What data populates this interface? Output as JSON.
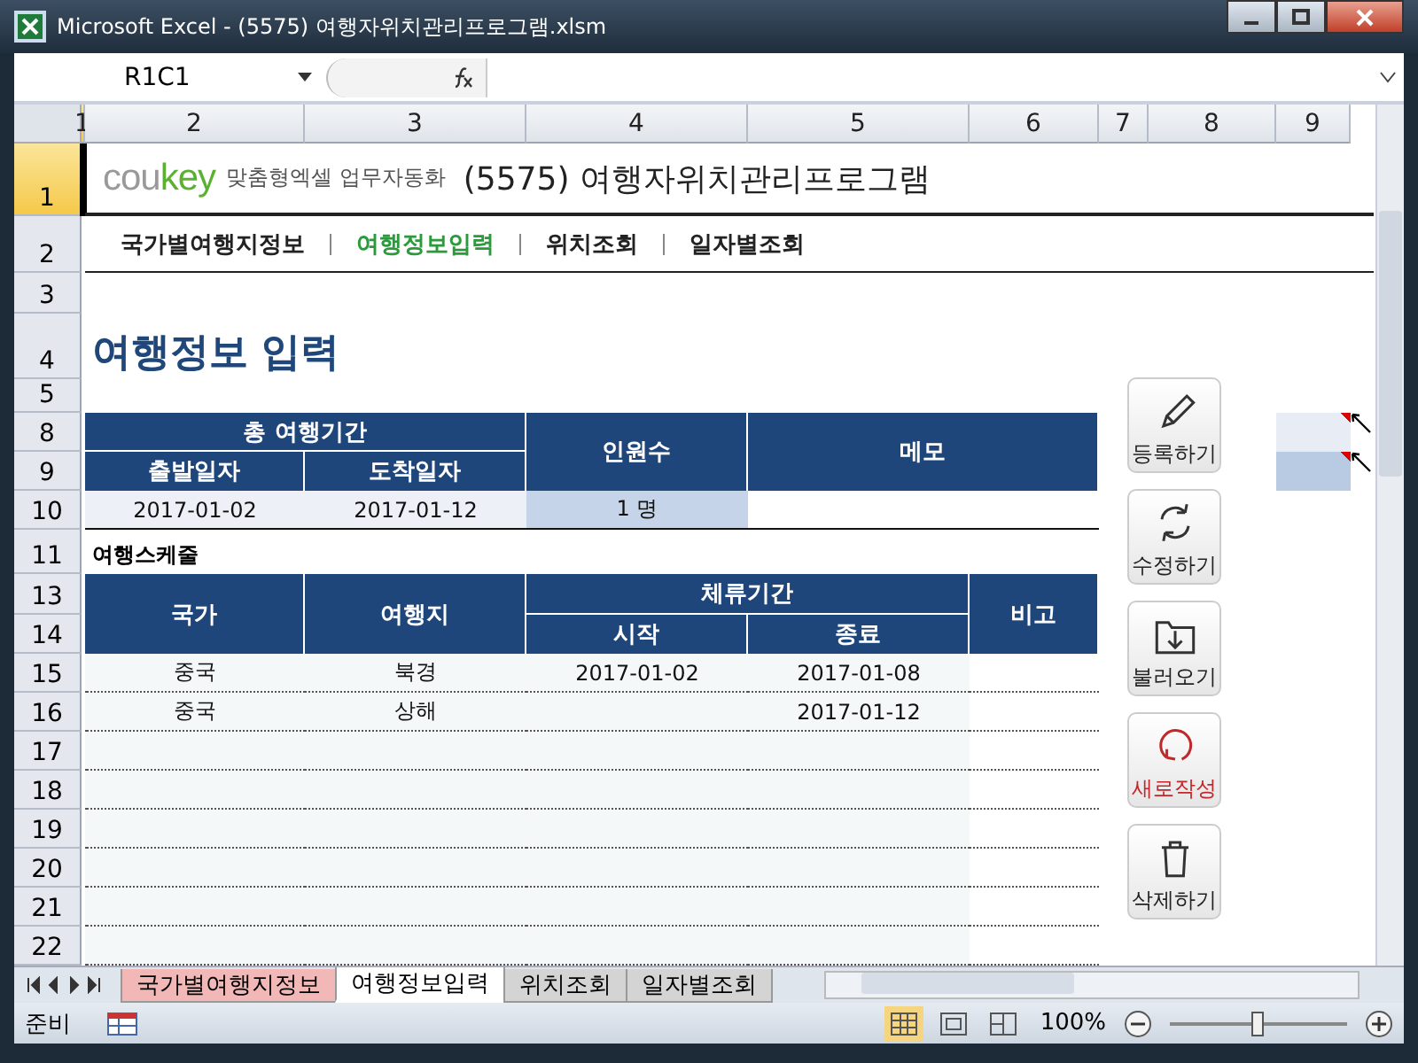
{
  "window": {
    "title": "Microsoft Excel - (5575) 여행자위치관리프로그램.xlsm"
  },
  "formula_bar": {
    "name_box": "R1C1"
  },
  "columns": [
    {
      "label": "1",
      "selected": true
    },
    {
      "label": "2",
      "selected": false
    },
    {
      "label": "3",
      "selected": false
    },
    {
      "label": "4",
      "selected": false
    },
    {
      "label": "5",
      "selected": false
    },
    {
      "label": "6",
      "selected": false
    },
    {
      "label": "7",
      "selected": false
    },
    {
      "label": "8",
      "selected": false
    },
    {
      "label": "9",
      "selected": false
    }
  ],
  "rows": [
    {
      "label": "1",
      "selected": true
    },
    {
      "label": "2",
      "selected": false
    },
    {
      "label": "3",
      "selected": false
    },
    {
      "label": "4",
      "selected": false
    },
    {
      "label": "5",
      "selected": false
    },
    {
      "label": "8",
      "selected": false
    },
    {
      "label": "9",
      "selected": false
    },
    {
      "label": "10",
      "selected": false
    },
    {
      "label": "11",
      "selected": false
    },
    {
      "label": "13",
      "selected": false
    },
    {
      "label": "14",
      "selected": false
    },
    {
      "label": "15",
      "selected": false
    },
    {
      "label": "16",
      "selected": false
    },
    {
      "label": "17",
      "selected": false
    },
    {
      "label": "18",
      "selected": false
    },
    {
      "label": "19",
      "selected": false
    },
    {
      "label": "20",
      "selected": false
    },
    {
      "label": "21",
      "selected": false
    },
    {
      "label": "22",
      "selected": false
    }
  ],
  "header": {
    "logo": "coukey",
    "tagline": "맞춤형엑셀 업무자동화",
    "title": "(5575) 여행자위치관리프로그램"
  },
  "nav": [
    {
      "label": "국가별여행지정보",
      "selected": false
    },
    {
      "label": "여행정보입력",
      "selected": true
    },
    {
      "label": "위치조회",
      "selected": false
    },
    {
      "label": "일자별조회",
      "selected": false
    }
  ],
  "page_title": "여행정보 입력",
  "summary": {
    "group": "총 여행기간",
    "departure_header": "출발일자",
    "arrival_header": "도착일자",
    "people_header": "인원수",
    "memo_header": "메모",
    "departure": "2017-01-02",
    "arrival": "2017-01-12",
    "people": "1 명"
  },
  "schedule": {
    "label": "여행스케줄",
    "country_header": "국가",
    "place_header": "여행지",
    "stay_header": "체류기간",
    "start_header": "시작",
    "end_header": "종료",
    "note_header": "비고",
    "rows": [
      {
        "country": "중국",
        "place": "북경",
        "start": "2017-01-02",
        "end": "2017-01-08"
      },
      {
        "country": "중국",
        "place": "상해",
        "end": "2017-01-12"
      }
    ]
  },
  "buttons": [
    {
      "label": "등록하기",
      "kind": "pencil"
    },
    {
      "label": "수정하기",
      "kind": "refresh"
    },
    {
      "label": "불러오기",
      "kind": "folder"
    },
    {
      "label": "새로작성",
      "kind": "new"
    },
    {
      "label": "삭제하기",
      "kind": "trash"
    }
  ],
  "sheet_tabs": [
    {
      "label": "국가별여행지정보",
      "selected": false,
      "color": "#f2b8b8"
    },
    {
      "label": "여행정보입력",
      "selected": true,
      "color": "#ffffff"
    },
    {
      "label": "위치조회",
      "selected": false,
      "color": "#d4d4d4"
    },
    {
      "label": "일자별조회",
      "selected": false,
      "color": "#d4d4d4"
    }
  ],
  "status_bar": {
    "status": "준비",
    "zoom": "100%"
  },
  "zoom_slider": {
    "level": 0.5
  }
}
